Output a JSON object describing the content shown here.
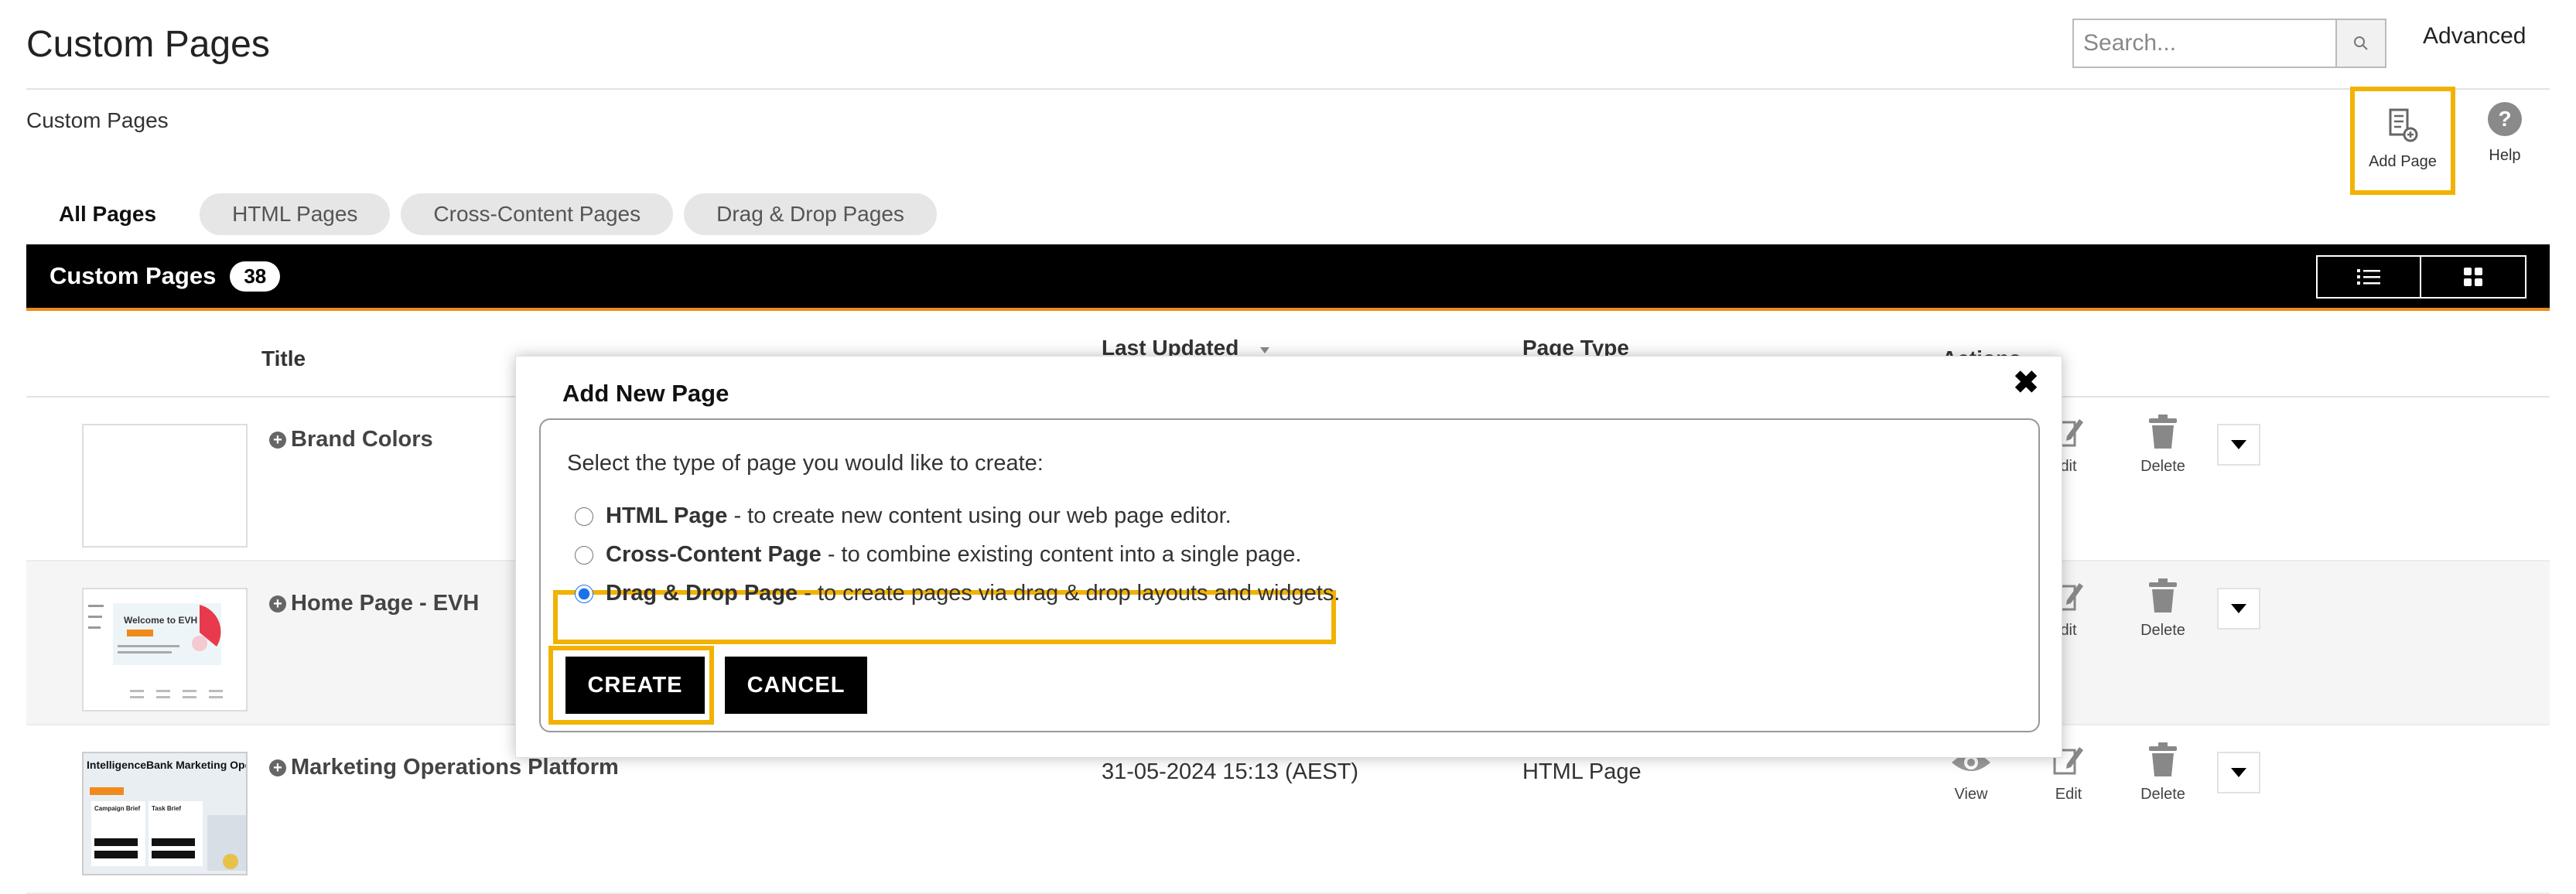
{
  "header": {
    "title": "Custom Pages",
    "search_placeholder": "Search...",
    "advanced_label": "Advanced"
  },
  "breadcrumb": "Custom Pages",
  "toolbar": {
    "add_page_label": "Add Page",
    "help_label": "Help"
  },
  "tabs": [
    {
      "label": "All Pages",
      "active": true
    },
    {
      "label": "HTML Pages",
      "active": false
    },
    {
      "label": "Cross-Content Pages",
      "active": false
    },
    {
      "label": "Drag & Drop Pages",
      "active": false
    }
  ],
  "list_bar": {
    "title": "Custom Pages",
    "count": "38"
  },
  "table": {
    "columns": {
      "title": "Title",
      "last_updated": "Last Updated",
      "page_type": "Page Type",
      "actions": "Actions"
    },
    "rows": [
      {
        "title": "Brand Colors",
        "last_updated": "",
        "page_type": ""
      },
      {
        "title": "Home Page - EVH",
        "last_updated": "",
        "page_type": ""
      },
      {
        "title": "Marketing Operations Platform",
        "last_updated": "31-05-2024 15:13 (AEST)",
        "page_type": "HTML Page"
      }
    ],
    "action_labels": {
      "view": "View",
      "edit": "Edit",
      "edit_partial": "dit",
      "delete": "Delete"
    },
    "thumb_texts": {
      "evh_heading": "Welcome to EVH",
      "mop_heading": "IntelligenceBank Marketing Operations Platfo",
      "mop_col1": "Campaign Brief",
      "mop_col2": "Task Brief"
    }
  },
  "modal": {
    "title": "Add New Page",
    "prompt": "Select the type of page you would like to create:",
    "options": [
      {
        "name": "HTML Page",
        "desc": " - to create new content using our web page editor.",
        "selected": false
      },
      {
        "name": "Cross-Content Page",
        "desc": " - to combine existing content into a single page.",
        "selected": false
      },
      {
        "name": "Drag & Drop Page",
        "desc": " - to create pages via drag & drop layouts and widgets.",
        "selected": true
      }
    ],
    "create_label": "CREATE",
    "cancel_label": "CANCEL",
    "close_glyph": "✖"
  },
  "colors": {
    "highlight": "#f2b200",
    "bar": "#000000",
    "bar_accent": "#f08a1c"
  }
}
